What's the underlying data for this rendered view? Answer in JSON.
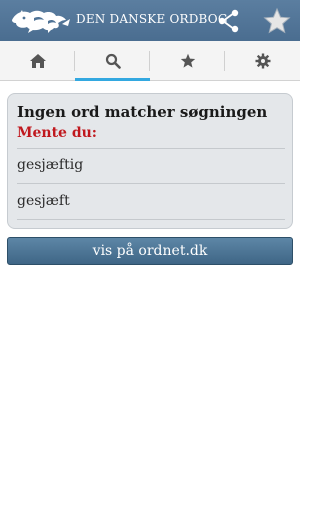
{
  "app": {
    "title": "DEN DANSKE ORDBOG",
    "colors": {
      "appbar": "#4f7396",
      "accent": "#33a8e0",
      "alert": "#c0181e",
      "button": "#4a7090"
    }
  },
  "header": {
    "logo_icon": "lion-logo-icon",
    "share_icon": "share-icon",
    "favorite_icon": "star-icon"
  },
  "tabs": [
    {
      "name": "home",
      "icon": "home-icon",
      "active": false
    },
    {
      "name": "search",
      "icon": "search-icon",
      "active": true
    },
    {
      "name": "favorites",
      "icon": "star-icon",
      "active": false
    },
    {
      "name": "settings",
      "icon": "gear-icon",
      "active": false
    }
  ],
  "result": {
    "title": "Ingen ord matcher søgningen",
    "suggest_label": "Mente du:",
    "suggestions": [
      "gesjæftig",
      "gesjæft"
    ]
  },
  "ordnet_button": {
    "label": "vis på ordnet.dk"
  }
}
